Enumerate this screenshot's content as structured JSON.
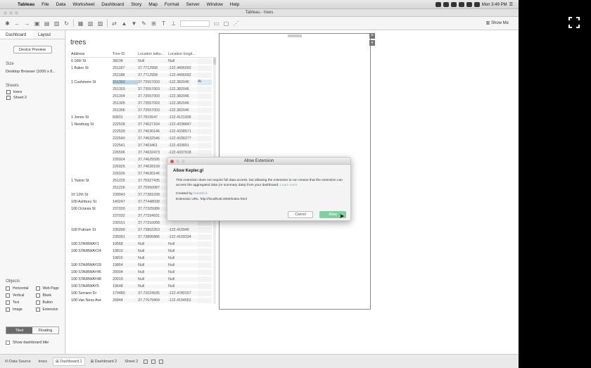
{
  "menubar": {
    "apple": "",
    "items": [
      "Tableau",
      "File",
      "Data",
      "Worksheet",
      "Dashboard",
      "Story",
      "Map",
      "Format",
      "Server",
      "Window",
      "Help"
    ],
    "clock": "Mon 3:49 PM"
  },
  "window": {
    "title": "Tableau - trees"
  },
  "toolbar": {
    "show_me": "Show Me"
  },
  "left_panel": {
    "tabs": [
      "Dashboard",
      "Layout"
    ],
    "device_button": "Device Preview",
    "size_label": "Size",
    "size_value": "Desktop Browser (1000 x 8...",
    "sheets_label": "Sheets",
    "sheets": [
      "trees",
      "Sheet 2"
    ],
    "objects_label": "Objects",
    "objects": [
      "Horizontal",
      "Web Page",
      "Vertical",
      "Blank",
      "Text",
      "Button",
      "Image",
      "Extension"
    ],
    "tiled": "Tiled",
    "floating": "Floating",
    "show_title": "Show dashboard title"
  },
  "view": {
    "title": "trees",
    "columns": [
      "Address",
      "Tree ID",
      "Location latitu...",
      "Location longit..."
    ],
    "rows": [
      {
        "addr": "0 16th St",
        "id": "38234",
        "lat": "Null",
        "lon": "Null"
      },
      {
        "addr": "1 Baker St",
        "id": "251187",
        "lat": "37.7712958",
        "lon": "-122.4406092"
      },
      {
        "addr": "",
        "id": "251188",
        "lat": "37.7712958",
        "lon": "-122.4406092"
      },
      {
        "addr": "1 Cashmere St",
        "id": "251302",
        "lat": "37.73557003",
        "lon": "-122.382046",
        "sel": "At"
      },
      {
        "addr": "",
        "id": "251303",
        "lat": "37.73557003",
        "lon": "-122.382046"
      },
      {
        "addr": "",
        "id": "251304",
        "lat": "37.73557003",
        "lon": "-122.382046"
      },
      {
        "addr": "",
        "id": "251305",
        "lat": "37.73557003",
        "lon": "-122.382046"
      },
      {
        "addr": "",
        "id": "251306",
        "lat": "37.73557003",
        "lon": "-122.382046"
      },
      {
        "addr": "1 Jones St",
        "id": "83601",
        "lat": "37.7815547",
        "lon": "-122.4121936"
      },
      {
        "addr": "1 Newburg St",
        "id": "222538",
        "lat": "37.74627164",
        "lon": "-122.4338847"
      },
      {
        "addr": "",
        "id": "222539",
        "lat": "37.74630146",
        "lon": "-122.4338571"
      },
      {
        "addr": "",
        "id": "222540",
        "lat": "37.74632546",
        "lon": "-122.4338277"
      },
      {
        "addr": "",
        "id": "222541",
        "lat": "37.7463461",
        "lon": "-122.433801"
      },
      {
        "addr": "",
        "id": "226596",
        "lat": "37.74632473",
        "lon": "-122.4337918"
      },
      {
        "addr": "",
        "id": "226924",
        "lat": "37.74625595",
        "lon": ""
      },
      {
        "addr": "",
        "id": "226925",
        "lat": "37.74628109",
        "lon": ""
      },
      {
        "addr": "",
        "id": "226926",
        "lat": "37.74630146",
        "lon": ""
      },
      {
        "addr": "1 Yukon St",
        "id": "251225",
        "lat": "37.75927435",
        "lon": ""
      },
      {
        "addr": "",
        "id": "251226",
        "lat": "37.75950087",
        "lon": ""
      },
      {
        "addr": "10 12th St",
        "id": "239043",
        "lat": "37.77381038",
        "lon": ""
      },
      {
        "addr": "100 Ashbury St",
        "id": "140247",
        "lat": "37.77448038",
        "lon": ""
      },
      {
        "addr": "100 Octavia St",
        "id": "237030",
        "lat": "37.77325086",
        "lon": ""
      },
      {
        "addr": "",
        "id": "237032",
        "lat": "37.77334931",
        "lon": ""
      },
      {
        "addr": "",
        "id": "239151",
        "lat": "37.77316068",
        "lon": ""
      },
      {
        "addr": "100 Putnam St",
        "id": "235090",
        "lat": "37.73802253",
        "lon": "-122.410949"
      },
      {
        "addr": "",
        "id": "235091",
        "lat": "37.73806886",
        "lon": "-122.4109334"
      },
      {
        "addr": "100 STAIRWAY1",
        "id": "19568",
        "lat": "Null",
        "lon": "Null"
      },
      {
        "addr": "100 STAIRWAY24",
        "id": "19810",
        "lat": "Null",
        "lon": "Null"
      },
      {
        "addr": "",
        "id": "19815",
        "lat": "Null",
        "lon": "Null"
      },
      {
        "addr": "100 STAIRWAY29",
        "id": "19854",
        "lat": "Null",
        "lon": "Null"
      },
      {
        "addr": "100 STAIRWAY46",
        "id": "20004",
        "lat": "Null",
        "lon": "Null"
      },
      {
        "addr": "100 STAIRWAY48",
        "id": "20019",
        "lat": "Null",
        "lon": "Null"
      },
      {
        "addr": "100 STAIRWAY5",
        "id": "19648",
        "lat": "Null",
        "lon": "Null"
      },
      {
        "addr": "100 Serrano Dr",
        "id": "179480",
        "lat": "37.72024935",
        "lon": "-122.4780157"
      },
      {
        "addr": "100 Van Ness Ave",
        "id": "26844",
        "lat": "37.77679404",
        "lon": "-122.4194052"
      }
    ]
  },
  "extension_zone": {
    "close": "×",
    "more": "▾"
  },
  "dialog": {
    "title": "Allow Extension",
    "heading": "Allow Kepler.gl",
    "body": "This extension does not require full data access, but allowing the extension to run means that the extension can access the aggregated data (or summary data) from your dashboard.",
    "learn_more": "Learn more",
    "created_by_label": "Created by",
    "created_by_value": "DataBlick",
    "url_text": "Extension URL: http://localhost:3000/index.html",
    "cancel": "Cancel",
    "allow": "Allow"
  },
  "bottom_tabs": [
    "Data Source",
    "trees",
    "Dashboard 1",
    "Dashboard 2",
    "Sheet 2"
  ],
  "colors": {
    "allow_button": "#7fcf9f",
    "selected_cell": "#b8d4e8"
  }
}
